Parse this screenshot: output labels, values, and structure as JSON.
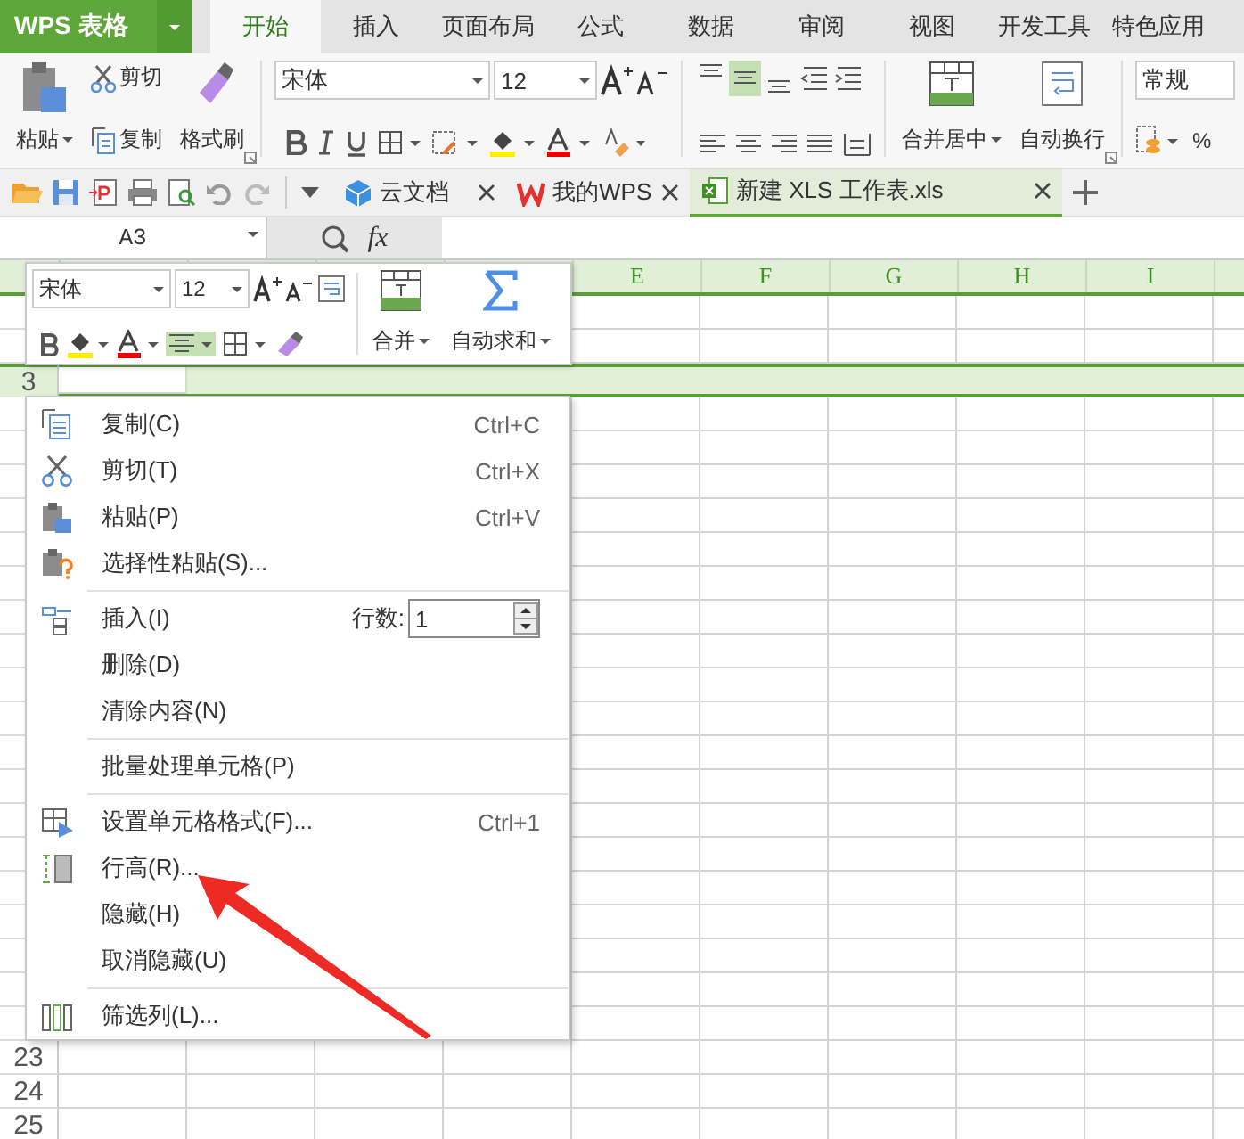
{
  "app": {
    "name": "WPS 表格"
  },
  "tabs": [
    {
      "label": "开始",
      "selected": true
    },
    {
      "label": "插入",
      "selected": false
    },
    {
      "label": "页面布局",
      "selected": false
    },
    {
      "label": "公式",
      "selected": false
    },
    {
      "label": "数据",
      "selected": false
    },
    {
      "label": "审阅",
      "selected": false
    },
    {
      "label": "视图",
      "selected": false
    },
    {
      "label": "开发工具",
      "selected": false
    },
    {
      "label": "特色应用",
      "selected": false
    }
  ],
  "ribbon": {
    "paste": "粘贴",
    "cut": "剪切",
    "copy": "复制",
    "format_painter": "格式刷",
    "font_name": "宋体",
    "font_size": "12",
    "vertical_align": [
      {
        "selected": false
      },
      {
        "selected": true
      },
      {
        "selected": false
      }
    ],
    "merge": "合并居中",
    "wrap": "自动换行",
    "number_format": "常规",
    "percent": "%"
  },
  "doc_tabs": [
    {
      "label": "云文档",
      "kind": "cloud",
      "selected": false
    },
    {
      "label": "我的WPS",
      "kind": "wps",
      "selected": false
    },
    {
      "label": "新建 XLS 工作表.xls",
      "kind": "sheet",
      "selected": true
    }
  ],
  "formula_bar": {
    "name_box": "A3",
    "fx": "fx"
  },
  "grid": {
    "columns": [
      {
        "label": "E"
      },
      {
        "label": "F"
      },
      {
        "label": "G"
      },
      {
        "label": "H"
      },
      {
        "label": "I"
      }
    ],
    "rows": [
      {
        "label": "3",
        "selected": true
      },
      {
        "label": "23",
        "selected": false
      },
      {
        "label": "24",
        "selected": false
      },
      {
        "label": "25",
        "selected": false
      }
    ]
  },
  "mini_toolbar": {
    "font_name": "宋体",
    "font_size": "12",
    "align_center_selected": true,
    "merge": "合并",
    "autosum": "自动求和"
  },
  "context_menu": {
    "items": [
      {
        "kind": "item",
        "label": "复制(C)",
        "shortcut": "Ctrl+C"
      },
      {
        "kind": "item",
        "label": "剪切(T)",
        "shortcut": "Ctrl+X"
      },
      {
        "kind": "item",
        "label": "粘贴(P)",
        "shortcut": "Ctrl+V"
      },
      {
        "kind": "item",
        "label": "选择性粘贴(S)..."
      },
      {
        "kind": "separator"
      },
      {
        "kind": "insert",
        "label": "插入(I)",
        "count_label": "行数:",
        "count": "1"
      },
      {
        "kind": "item",
        "label": "删除(D)"
      },
      {
        "kind": "item",
        "label": "清除内容(N)"
      },
      {
        "kind": "separator"
      },
      {
        "kind": "item",
        "label": "批量处理单元格(P)"
      },
      {
        "kind": "separator"
      },
      {
        "kind": "item",
        "label": "设置单元格格式(F)...",
        "shortcut": "Ctrl+1"
      },
      {
        "kind": "item",
        "label": "行高(R)..."
      },
      {
        "kind": "item",
        "label": "隐藏(H)"
      },
      {
        "kind": "item",
        "label": "取消隐藏(U)"
      },
      {
        "kind": "separator"
      },
      {
        "kind": "item",
        "label": "筛选列(L)..."
      }
    ]
  },
  "annotations": [
    {
      "kind": "arrow"
    }
  ]
}
